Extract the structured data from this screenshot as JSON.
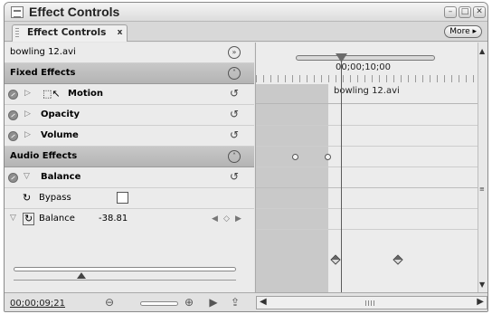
{
  "window": {
    "title": "Effect Controls"
  },
  "tab": {
    "label": "Effect Controls",
    "close_glyph": "x"
  },
  "more_button": {
    "label": "More ▸"
  },
  "clip": {
    "name": "bowling 12.avi"
  },
  "sections": {
    "fixed": {
      "label": "Fixed Effects"
    },
    "audio": {
      "label": "Audio Effects"
    }
  },
  "effects": {
    "motion": "Motion",
    "opacity": "Opacity",
    "volume": "Volume",
    "balance": "Balance"
  },
  "bypass": {
    "label": "Bypass",
    "checked": false
  },
  "balance_param": {
    "label": "Balance",
    "value": "-38.81"
  },
  "timeline": {
    "ruler_label": "00;00;10;00",
    "clip_label": "bowling 12.avi"
  },
  "footer": {
    "timecode": "00;00;09;21"
  },
  "icons": {
    "window_icon": "effect-controls-window-icon",
    "nav_left": "◀",
    "nav_diamond": "◇",
    "nav_right": "▶"
  }
}
